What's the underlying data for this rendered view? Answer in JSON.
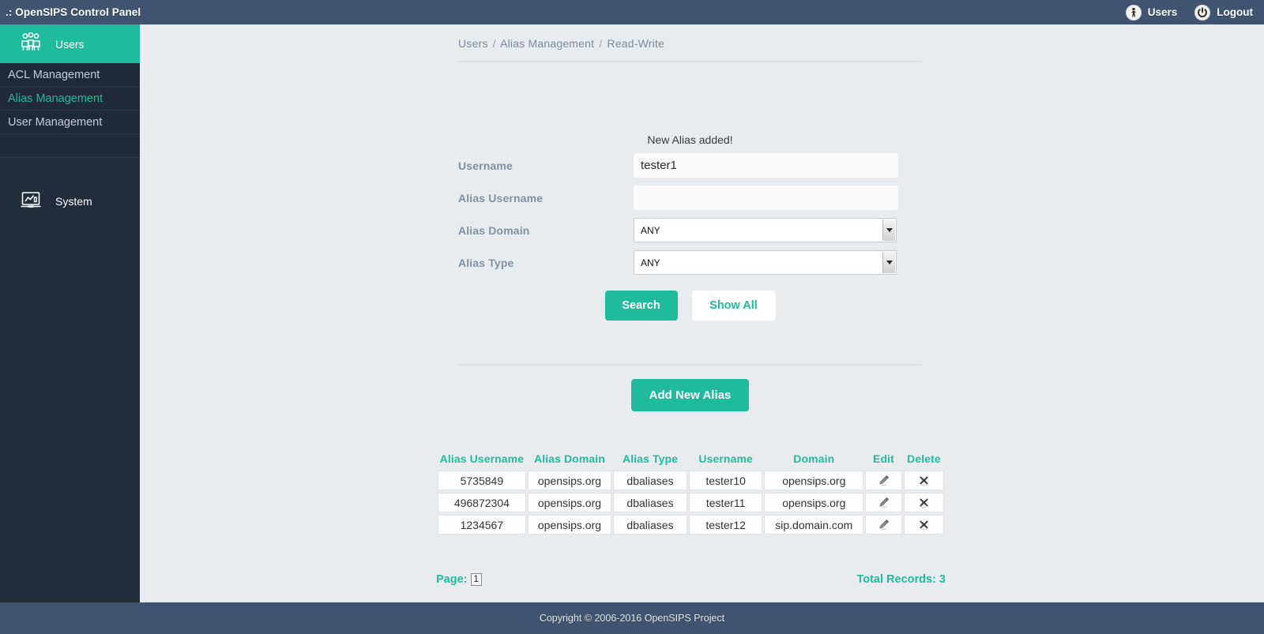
{
  "topbar": {
    "title": ".: OpenSIPS Control Panel",
    "users_label": "Users",
    "logout_label": "Logout"
  },
  "sidebar": {
    "main_items": [
      {
        "label": "Users",
        "icon": "users-group-icon",
        "active": true
      },
      {
        "label": "System",
        "icon": "system-monitor-icon",
        "active": false
      }
    ],
    "sub_items": [
      {
        "label": "ACL Management",
        "active": false
      },
      {
        "label": "Alias Management",
        "active": true
      },
      {
        "label": "User Management",
        "active": false
      }
    ]
  },
  "breadcrumb": {
    "items": [
      "Users",
      "Alias Management",
      "Read-Write"
    ],
    "separator": "/"
  },
  "form": {
    "message": "New Alias added!",
    "fields": [
      {
        "label": "Username",
        "type": "text",
        "value": "tester1",
        "placeholder": ""
      },
      {
        "label": "Alias Username",
        "type": "text",
        "value": "",
        "placeholder": ""
      },
      {
        "label": "Alias Domain",
        "type": "select",
        "value": "ANY"
      },
      {
        "label": "Alias Type",
        "type": "select",
        "value": "ANY"
      }
    ],
    "search_label": "Search",
    "show_all_label": "Show All"
  },
  "actions": {
    "add_new_label": "Add New Alias"
  },
  "table": {
    "columns": [
      "Alias Username",
      "Alias Domain",
      "Alias Type",
      "Username",
      "Domain",
      "",
      "Edit",
      "Delete"
    ],
    "rows": [
      {
        "alias_username": "5735849",
        "alias_domain": "opensips.org",
        "alias_type": "dbaliases",
        "username": "tester10",
        "domain": "opensips.org"
      },
      {
        "alias_username": "496872304",
        "alias_domain": "opensips.org",
        "alias_type": "dbaliases",
        "username": "tester11",
        "domain": "opensips.org"
      },
      {
        "alias_username": "1234567",
        "alias_domain": "opensips.org",
        "alias_type": "dbaliases",
        "username": "tester12",
        "domain": "sip.domain.com"
      }
    ],
    "page_label": "Page:",
    "page_number": "1",
    "total_records": "Total Records: 3"
  },
  "footer": {
    "copyright": "Copyright © 2006-2016 OpenSIPS Project"
  },
  "colors": {
    "accent_green": "#1fbc9c",
    "header_blue": "#3e5470",
    "sidebar_dark": "#222d3a",
    "page_bg": "#e9ecef"
  }
}
